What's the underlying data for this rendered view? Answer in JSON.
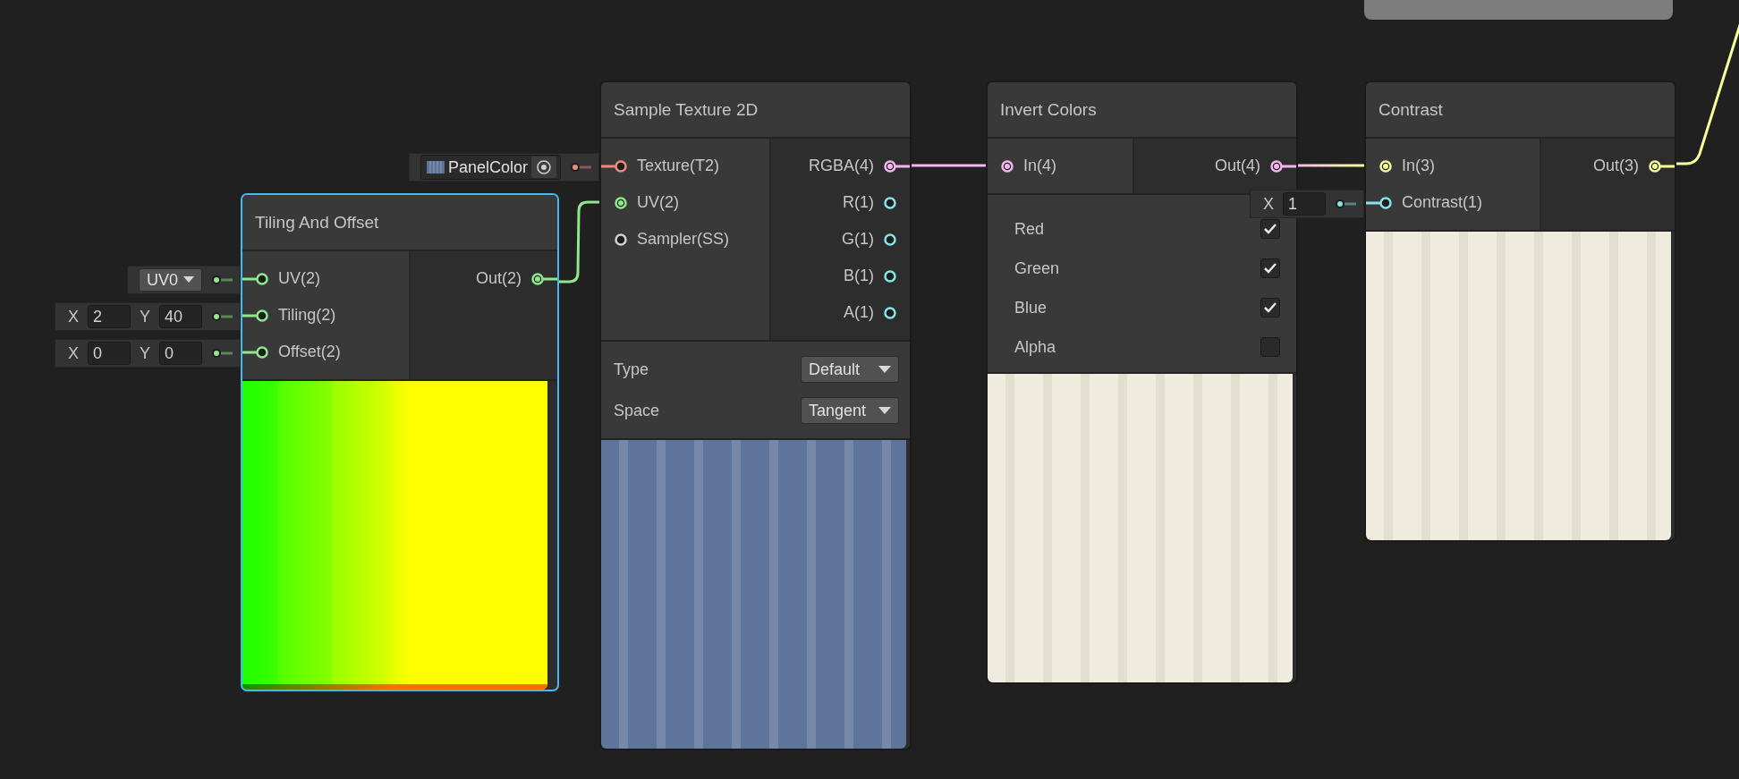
{
  "nodes": [
    {
      "kind": "tiling",
      "title": "Tiling And Offset",
      "selected": true,
      "inputs": [
        {
          "label": "UV(2)",
          "color": "#8fe88a",
          "connected": false,
          "inline": {
            "kind": "dropdown",
            "value": "UV0"
          }
        },
        {
          "label": "Tiling(2)",
          "color": "#8fe88a",
          "connected": false,
          "inline": {
            "kind": "vector",
            "fields": [
              {
                "axis": "X",
                "value": "2"
              },
              {
                "axis": "Y",
                "value": "40"
              }
            ]
          }
        },
        {
          "label": "Offset(2)",
          "color": "#8fe88a",
          "connected": false,
          "inline": {
            "kind": "vector",
            "fields": [
              {
                "axis": "X",
                "value": "0"
              },
              {
                "axis": "Y",
                "value": "0"
              }
            ]
          }
        }
      ],
      "outputs": [
        {
          "label": "Out(2)",
          "color": "#8fe88a",
          "connected": true
        }
      ]
    },
    {
      "kind": "sample",
      "title": "Sample Texture 2D",
      "selected": false,
      "inputs": [
        {
          "label": "Texture(T2)",
          "color": "#f08a7e",
          "connected": false,
          "inline": {
            "kind": "texture",
            "value": "PanelColor"
          }
        },
        {
          "label": "UV(2)",
          "color": "#8fe88a",
          "connected": true
        },
        {
          "label": "Sampler(SS)",
          "color": "#d0d0d0",
          "connected": false
        }
      ],
      "outputs": [
        {
          "label": "RGBA(4)",
          "color": "#f3b6ef",
          "connected": true
        },
        {
          "label": "R(1)",
          "color": "#84e4e7",
          "connected": false
        },
        {
          "label": "G(1)",
          "color": "#84e4e7",
          "connected": false
        },
        {
          "label": "B(1)",
          "color": "#84e4e7",
          "connected": false
        },
        {
          "label": "A(1)",
          "color": "#84e4e7",
          "connected": false
        }
      ],
      "settings": [
        {
          "label": "Type",
          "value": "Default"
        },
        {
          "label": "Space",
          "value": "Tangent"
        }
      ]
    },
    {
      "kind": "invert",
      "title": "Invert Colors",
      "selected": false,
      "inputs": [
        {
          "label": "In(4)",
          "color": "#f3b6ef",
          "connected": true
        }
      ],
      "outputs": [
        {
          "label": "Out(4)",
          "color": "#f3b6ef",
          "connected": true
        }
      ],
      "channels": [
        {
          "label": "Red",
          "checked": true
        },
        {
          "label": "Green",
          "checked": true
        },
        {
          "label": "Blue",
          "checked": true
        },
        {
          "label": "Alpha",
          "checked": false
        }
      ]
    },
    {
      "kind": "contrast",
      "title": "Contrast",
      "selected": false,
      "inputs": [
        {
          "label": "In(3)",
          "color": "#f6ff9a",
          "connected": true
        },
        {
          "label": "Contrast(1)",
          "color": "#84e4e7",
          "connected": false,
          "inline": {
            "kind": "vector",
            "fields": [
              {
                "axis": "X",
                "value": "1"
              }
            ]
          }
        }
      ],
      "outputs": [
        {
          "label": "Out(3)",
          "color": "#f6ff9a",
          "connected": true
        }
      ]
    }
  ]
}
